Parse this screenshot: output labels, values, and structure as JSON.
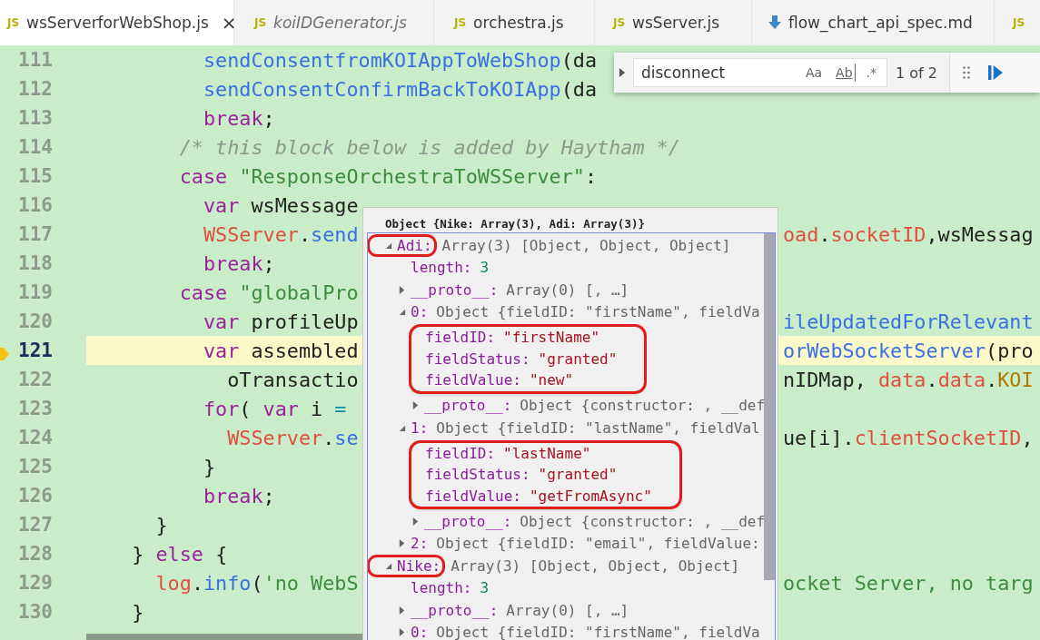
{
  "tabs": [
    {
      "kind": "js",
      "icon_text": "JS",
      "label": "wsServerforWebShop.js",
      "selected": true,
      "preview": false,
      "close": "×"
    },
    {
      "kind": "js",
      "icon_text": "JS",
      "label": "koiIDGenerator.js",
      "selected": false,
      "preview": true
    },
    {
      "kind": "js",
      "icon_text": "JS",
      "label": "orchestra.js",
      "selected": false,
      "preview": false
    },
    {
      "kind": "js",
      "icon_text": "JS",
      "label": "wsServer.js",
      "selected": false,
      "preview": false
    },
    {
      "kind": "md",
      "label": "flow_chart_api_spec.md",
      "selected": false,
      "preview": false
    },
    {
      "kind": "js",
      "icon_text": "JS",
      "selected": false
    }
  ],
  "find_widget": {
    "query": "disconnect",
    "options": [
      {
        "label": "Aa",
        "on": false
      },
      {
        "label": "Ab",
        "on": false
      },
      {
        "label": ".*",
        "on": false
      }
    ],
    "count": "1 of 2"
  },
  "lines": [
    {
      "number": "111",
      "current": false,
      "tokens": [
        {
          "kind": "fn",
          "text": "        sendConsentfromKOIAppToWebShop"
        },
        {
          "kind": "plain",
          "text": "(da"
        }
      ]
    },
    {
      "number": "112",
      "current": false,
      "tokens": [
        {
          "kind": "fn",
          "text": "        sendConsentConfirmBackToKOIApp"
        },
        {
          "kind": "plain",
          "text": "(da"
        }
      ]
    },
    {
      "number": "113",
      "current": false,
      "tokens": [
        {
          "kind": "kw",
          "text": "        break"
        },
        {
          "kind": "plain",
          "text": ";"
        }
      ]
    },
    {
      "number": "114",
      "current": false,
      "tokens": [
        {
          "kind": "comment",
          "text": "      /* this block below is added by Haytham */"
        }
      ]
    },
    {
      "number": "115",
      "current": false,
      "tokens": [
        {
          "kind": "kw",
          "text": "      case "
        },
        {
          "kind": "str",
          "text": "\"ResponseOrchestraToWSServer\""
        },
        {
          "kind": "plain",
          "text": ":"
        }
      ]
    },
    {
      "number": "116",
      "current": false,
      "tokens": [
        {
          "kind": "kw",
          "text": "        var "
        },
        {
          "kind": "plain",
          "text": "wsMessage"
        }
      ]
    },
    {
      "number": "117",
      "current": false,
      "tokens": [
        {
          "kind": "obj",
          "text": "        WSServer"
        },
        {
          "kind": "plain",
          "text": "."
        },
        {
          "kind": "fn",
          "text": "send"
        }
      ],
      "tail": [
        {
          "kind": "obj",
          "text": "oad"
        },
        {
          "kind": "plain",
          "text": "."
        },
        {
          "kind": "obj",
          "text": "socketID"
        },
        {
          "kind": "plain",
          "text": ",wsMessag"
        }
      ]
    },
    {
      "number": "118",
      "current": false,
      "tokens": [
        {
          "kind": "kw",
          "text": "        break"
        },
        {
          "kind": "plain",
          "text": ";"
        }
      ]
    },
    {
      "number": "119",
      "current": false,
      "tokens": [
        {
          "kind": "kw",
          "text": "      case "
        },
        {
          "kind": "str",
          "text": "\"globalPro"
        }
      ]
    },
    {
      "number": "120",
      "current": false,
      "tokens": [
        {
          "kind": "kw",
          "text": "        var "
        },
        {
          "kind": "plain",
          "text": "profileUp"
        }
      ],
      "tail": [
        {
          "kind": "fn",
          "text": "ileUpdatedForRelevant"
        }
      ]
    },
    {
      "number": "121",
      "current": true,
      "tokens": [
        {
          "kind": "kw",
          "text": "        var "
        },
        {
          "kind": "plain",
          "text": "assembled"
        }
      ],
      "tail": [
        {
          "kind": "fn",
          "text": "orWebSocketServer"
        },
        {
          "kind": "plain",
          "text": "(pro"
        }
      ]
    },
    {
      "number": "122",
      "current": false,
      "tokens": [
        {
          "kind": "plain",
          "text": "          oTransactio"
        }
      ],
      "tail": [
        {
          "kind": "plain",
          "text": "nIDMap, "
        },
        {
          "kind": "obj",
          "text": "data"
        },
        {
          "kind": "plain",
          "text": "."
        },
        {
          "kind": "obj",
          "text": "data"
        },
        {
          "kind": "plain",
          "text": "."
        },
        {
          "kind": "type",
          "text": "KOI"
        }
      ]
    },
    {
      "number": "123",
      "current": false,
      "tokens": [
        {
          "kind": "kw",
          "text": "        for"
        },
        {
          "kind": "plain",
          "text": "( "
        },
        {
          "kind": "kw",
          "text": "var "
        },
        {
          "kind": "plain",
          "text": "i "
        },
        {
          "kind": "op",
          "text": "="
        }
      ]
    },
    {
      "number": "124",
      "current": false,
      "tokens": [
        {
          "kind": "obj",
          "text": "          WSServer"
        },
        {
          "kind": "plain",
          "text": "."
        },
        {
          "kind": "fn",
          "text": "se"
        }
      ],
      "tail": [
        {
          "kind": "plain",
          "text": "ue[i]."
        },
        {
          "kind": "obj",
          "text": "clientSocketID"
        },
        {
          "kind": "plain",
          "text": ","
        }
      ]
    },
    {
      "number": "125",
      "current": false,
      "tokens": [
        {
          "kind": "plain",
          "text": "        }"
        }
      ]
    },
    {
      "number": "126",
      "current": false,
      "tokens": [
        {
          "kind": "kw",
          "text": "        break"
        },
        {
          "kind": "plain",
          "text": ";"
        }
      ]
    },
    {
      "number": "127",
      "current": false,
      "tokens": [
        {
          "kind": "plain",
          "text": "    }"
        }
      ]
    },
    {
      "number": "128",
      "current": false,
      "tokens": [
        {
          "kind": "plain",
          "text": "  } "
        },
        {
          "kind": "kw",
          "text": "else "
        },
        {
          "kind": "plain",
          "text": "{"
        }
      ]
    },
    {
      "number": "129",
      "current": false,
      "tokens": [
        {
          "kind": "obj",
          "text": "    log"
        },
        {
          "kind": "plain",
          "text": "."
        },
        {
          "kind": "fn",
          "text": "info"
        },
        {
          "kind": "plain",
          "text": "("
        },
        {
          "kind": "str",
          "text": "'no WebS"
        }
      ],
      "tail": [
        {
          "kind": "str",
          "text": "ocket Server, no targ"
        }
      ]
    },
    {
      "number": "130",
      "current": false,
      "tokens": [
        {
          "kind": "plain",
          "text": "  }"
        }
      ]
    }
  ],
  "inspector": {
    "header": "Object {Nike: Array(3), Adi: Array(3)}",
    "tree": [
      {
        "key": "Adi:",
        "value": "Array(3) [Object, Object, Object]",
        "kind": "summary",
        "expanded": true,
        "circled": true,
        "children": [
          {
            "key": "length:",
            "value": "3",
            "kind": "number"
          },
          {
            "key": "__proto__:",
            "value": "Array(0) [, …]",
            "kind": "summary",
            "expanded": false
          },
          {
            "key": "0:",
            "value": "Object {fieldID: \"firstName\", fieldVa",
            "kind": "summary",
            "expanded": true,
            "fields_circled": true,
            "children": [
              {
                "key": "fieldID:",
                "value": "\"firstName\"",
                "kind": "string"
              },
              {
                "key": "fieldStatus:",
                "value": "\"granted\"",
                "kind": "string"
              },
              {
                "key": "fieldValue:",
                "value": "\"new\"",
                "kind": "string"
              },
              {
                "key": "__proto__:",
                "value": "Object {constructor: , __def",
                "kind": "summary",
                "expanded": false
              }
            ]
          },
          {
            "key": "1:",
            "value": "Object {fieldID: \"lastName\", fieldVal",
            "kind": "summary",
            "expanded": true,
            "fields_circled": true,
            "children": [
              {
                "key": "fieldID:",
                "value": "\"lastName\"",
                "kind": "string"
              },
              {
                "key": "fieldStatus:",
                "value": "\"granted\"",
                "kind": "string"
              },
              {
                "key": "fieldValue:",
                "value": "\"getFromAsync\"",
                "kind": "string"
              },
              {
                "key": "__proto__:",
                "value": "Object {constructor: , __def",
                "kind": "summary",
                "expanded": false
              }
            ]
          },
          {
            "key": "2:",
            "value": "Object {fieldID: \"email\", fieldValue:",
            "kind": "summary",
            "expanded": false
          }
        ]
      },
      {
        "key": "Nike:",
        "value": "Array(3) [Object, Object, Object]",
        "kind": "summary",
        "expanded": true,
        "circled": true,
        "children": [
          {
            "key": "length:",
            "value": "3",
            "kind": "number"
          },
          {
            "key": "__proto__:",
            "value": "Array(0) [, …]",
            "kind": "summary",
            "expanded": false
          },
          {
            "key": "0:",
            "value": "Object {fieldID: \"firstName\", fieldVa",
            "kind": "summary",
            "expanded": false
          }
        ]
      }
    ]
  }
}
